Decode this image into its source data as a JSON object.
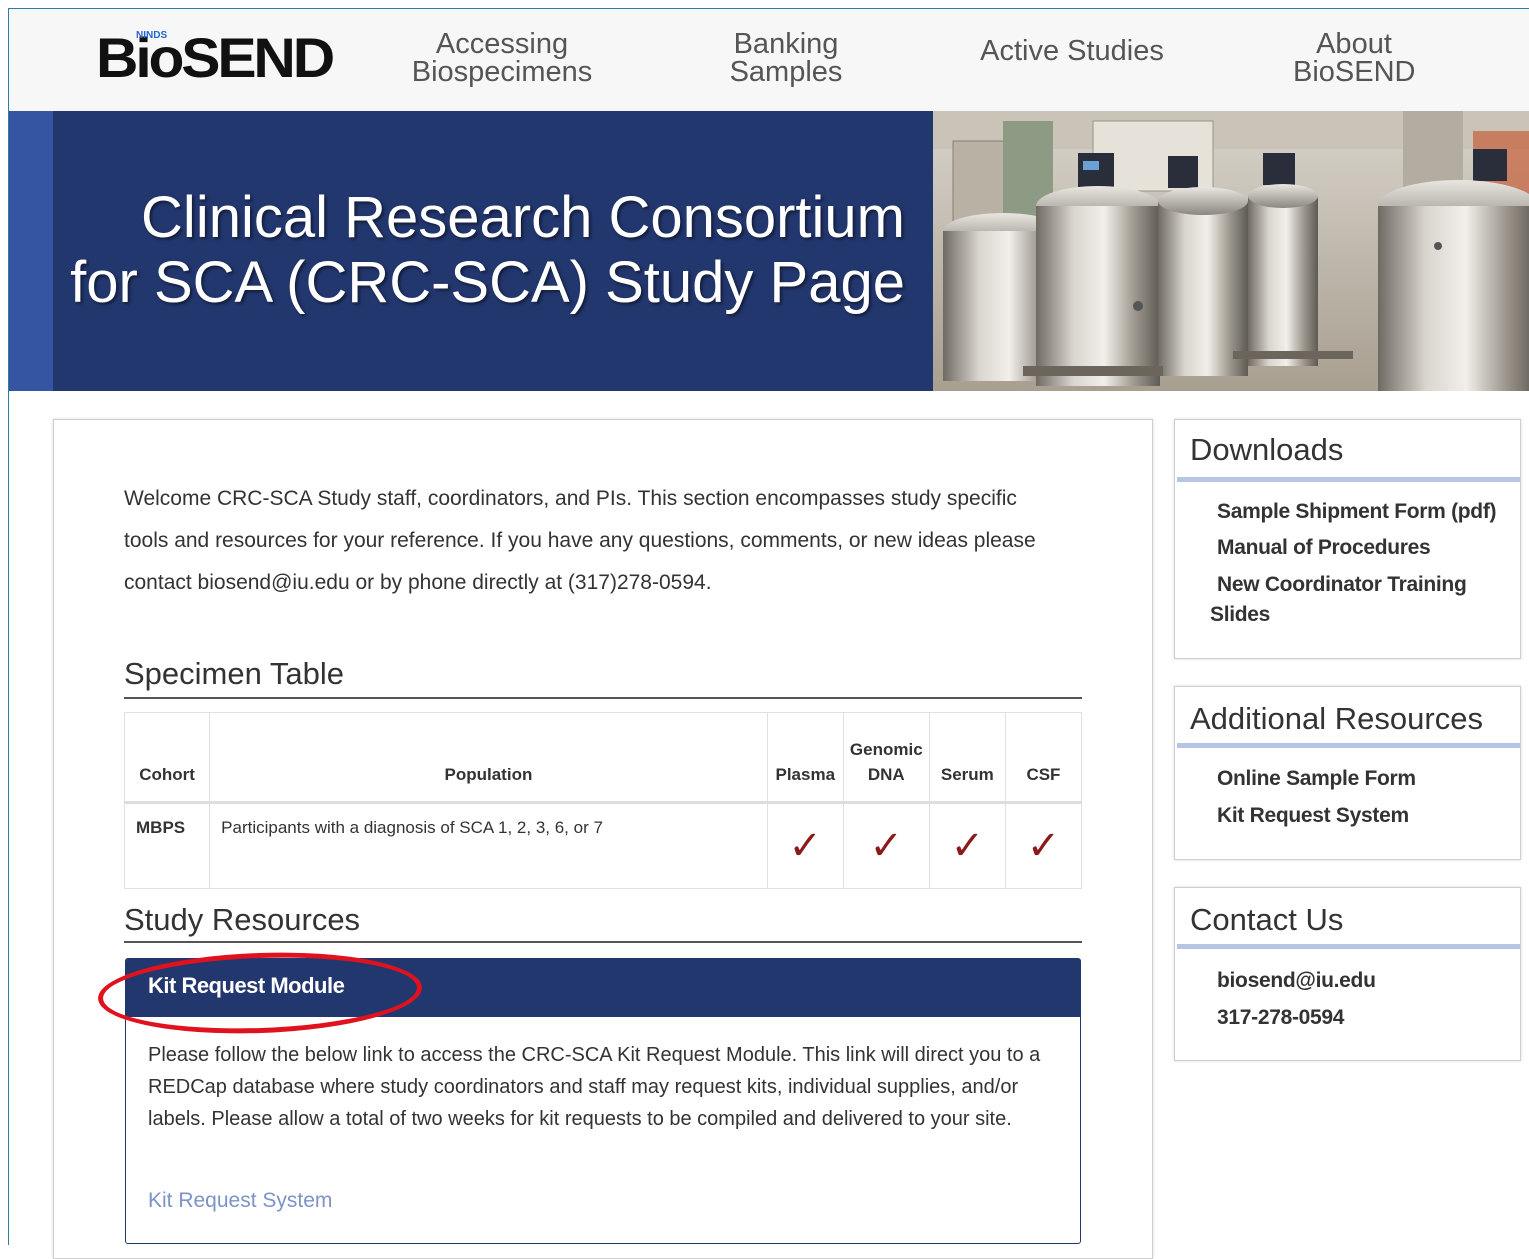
{
  "header": {
    "logo_text": "BioSEND",
    "logo_super": "NINDS",
    "nav": [
      {
        "line1": "Accessing",
        "line2": "Biospecimens"
      },
      {
        "line1": "Banking",
        "line2": "Samples"
      },
      {
        "line1": "Active Studies",
        "line2": ""
      },
      {
        "line1": "About",
        "line2": "BioSEND"
      }
    ]
  },
  "hero": {
    "title_line1": "Clinical Research Consortium",
    "title_line2": "for SCA (CRC-SCA) Study Page"
  },
  "main": {
    "intro": "Welcome CRC-SCA Study staff, coordinators, and PIs. This section encompasses study specific tools and resources for your reference. If you have any questions, comments, or new ideas please contact biosend@iu.edu or by phone directly at (317)278-0594.",
    "specimen_title": "Specimen Table",
    "table": {
      "headers": [
        "Cohort",
        "Population",
        "Plasma",
        "Genomic DNA",
        "Serum",
        "CSF"
      ],
      "rows": [
        {
          "cohort": "MBPS",
          "population": "Participants with a diagnosis of SCA 1, 2, 3, 6, or 7",
          "plasma": "✓",
          "dna": "✓",
          "serum": "✓",
          "csf": "✓"
        }
      ]
    },
    "resources_title": "Study Resources",
    "panel": {
      "title": "Kit Request Module",
      "body": "Please follow the below link to access the CRC-SCA Kit Request Module. This link will direct you to a REDCap database where study coordinators and staff may request kits, individual supplies, and/or labels. Please allow a total of two weeks for kit requests to be compiled and delivered to your site.",
      "link": "Kit Request System"
    }
  },
  "sidebar": {
    "downloads": {
      "title": "Downloads",
      "links": [
        "Sample Shipment Form (pdf)",
        "Manual of Procedures",
        "New Coordinator Training",
        "Slides"
      ]
    },
    "additional": {
      "title": "Additional Resources",
      "links": [
        "Online Sample Form",
        "Kit Request System"
      ]
    },
    "contact": {
      "title": "Contact Us",
      "email": "biosend@iu.edu",
      "phone": "317-278-0594"
    }
  },
  "colors": {
    "navy": "#23376f",
    "accent_strip": "#3555a3",
    "check": "#8b1a1a",
    "annotation": "#e0121d",
    "link": "#7c93c8"
  }
}
